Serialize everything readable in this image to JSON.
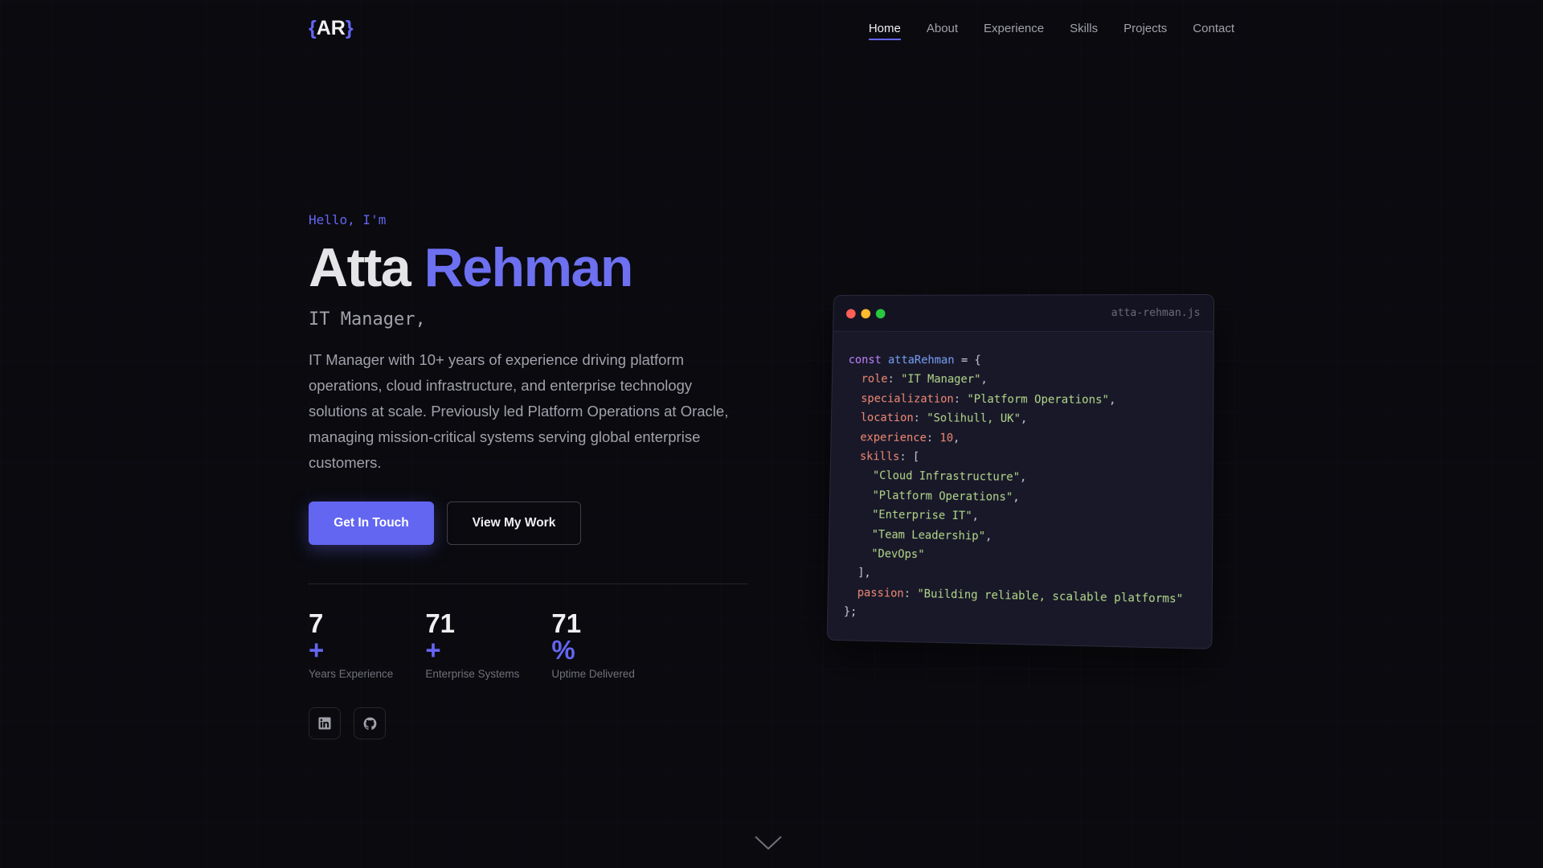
{
  "logo": {
    "open": "{",
    "text": "AR",
    "close": "}"
  },
  "nav": [
    {
      "label": "Home",
      "active": true
    },
    {
      "label": "About"
    },
    {
      "label": "Experience"
    },
    {
      "label": "Skills"
    },
    {
      "label": "Projects"
    },
    {
      "label": "Contact"
    }
  ],
  "hero": {
    "greeting": "Hello, I'm",
    "first_name": "Atta",
    "last_name": "Rehman",
    "role": "IT Manager,",
    "description": "IT Manager with 10+ years of experience driving platform operations, cloud infrastructure, and enterprise technology solutions at scale. Previously led Platform Operations at Oracle, managing mission-critical systems serving global enterprise customers.",
    "primary_button": "Get In Touch",
    "secondary_button": "View My Work"
  },
  "stats": [
    {
      "value": "7",
      "suffix": "+",
      "label": "Years Experience"
    },
    {
      "value": "71",
      "suffix": "+",
      "label": "Enterprise Systems"
    },
    {
      "value": "71",
      "suffix": "%",
      "label": "Uptime Delivered"
    }
  ],
  "social": [
    {
      "icon": "linkedin-icon"
    },
    {
      "icon": "github-icon"
    }
  ],
  "code": {
    "filename": "atta-rehman.js",
    "keyword": "const",
    "var": "attaRehman",
    "assign": " = {",
    "role_key": "role",
    "role_val": "\"IT Manager\"",
    "spec_key": "specialization",
    "spec_val": "\"Platform Operations\"",
    "loc_key": "location",
    "loc_val": "\"Solihull, UK\"",
    "exp_key": "experience",
    "exp_val": "10",
    "skills_key": "skills",
    "skills": [
      "\"Cloud Infrastructure\"",
      "\"Platform Operations\"",
      "\"Enterprise IT\"",
      "\"Team Leadership\"",
      "\"DevOps\""
    ],
    "passion_key": "passion",
    "passion_val": "\"Building reliable, scalable platforms\""
  },
  "colors": {
    "accent": "#6366f1",
    "bg": "#0a0a0f",
    "red": "#ff5f57",
    "yellow": "#febc2e",
    "green": "#28c840"
  }
}
